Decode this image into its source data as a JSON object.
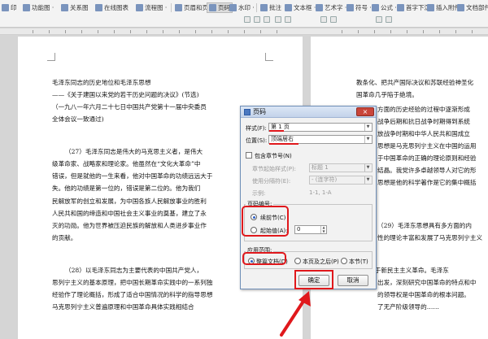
{
  "ribbon": {
    "row1": [
      {
        "key": "print",
        "label": "印"
      },
      {
        "key": "func_map",
        "label": "功能图 ·"
      },
      {
        "key": "relation_map",
        "label": "关系图"
      },
      {
        "key": "online_chart",
        "label": "在线图表"
      },
      {
        "key": "flowchart",
        "label": "流程图 ·"
      },
      {
        "key": "header_footer",
        "label": "页眉和页脚"
      },
      {
        "key": "page_number",
        "label": "页码"
      },
      {
        "key": "watermark",
        "label": "水印 ·"
      },
      {
        "key": "comment",
        "label": "批注"
      },
      {
        "key": "textbox",
        "label": "文本框 ·"
      },
      {
        "key": "wordart",
        "label": "艺术字 ·"
      },
      {
        "key": "symbol",
        "label": "符号 ·"
      },
      {
        "key": "formula",
        "label": "公式 ·"
      },
      {
        "key": "first_char_sink",
        "label": "首字下沉"
      },
      {
        "key": "insert_attachment",
        "label": "插入附件"
      },
      {
        "key": "doc_parts",
        "label": "文档部件 ·"
      }
    ]
  },
  "page1_lines": [
    "毛泽东同志的历史地位和毛泽东思想",
    "——《关于建国以来党的若干历史问题的决议》(节选)",
    "（一九八一年六月二十七日中国共产党第十一届中央委员",
    "全体会议一致通过)",
    "（27）毛泽东同志是伟大的马克思主义者，是伟大",
    "级革命家、战略家和理论家。他虽然在“文化大革命”中",
    "错误，但是就他的一生来看，他对中国革命的功绩远远大于",
    "失。他的功绩是第一位的，错误是第二位的。他为我们",
    "民解放军的创立和发展，为中国各族人民解放事业的胜利",
    "人民共和国的缔造和中国社会主义事业的奠基，建立了永",
    "灭的功勋。他为世界被压迫民族的解放和人类进步事业作",
    "的贡献。",
    "（28）以毛泽东同志为主要代表的中国共产党人，",
    "思列宁主义的基本原理，把中国长期革命实践中的一系列独",
    "经验作了理论概括，形成了适合中国情况的科学的指导思想",
    "马克思列宁主义普遍原理和中国革命具体实践相结合"
  ],
  "page2_lines": [
    "教条化、把共产国际决议和苏联经验神圣化",
    "国革命几乎陷于绝境。",
    "方面的历史经验的过程中逐渐形成",
    "战争后期和抗日战争时期得到系统",
    "放战争时期和中华人民共和国成立",
    "思想是马克思列宁主义在中国的运用",
    "于中国革命的正确的理论原则和经验",
    "结晶。我党许多卓越领导人对它的形",
    "思想是他的科学著作是它的集中概括",
    "（29）毛泽东思想具有多方面的内",
    "性的理论丰富和发展了马克思列宁主义",
    "一、关于新民主主义革命。毛泽东",
    "出发，深刻研究中国革命的特点和中",
    "的领导权是中国革命的根本问题。",
    "了无产阶级领导的……"
  ],
  "dialog": {
    "title": "页码",
    "close_symbol": "×",
    "style_label": "样式(F):",
    "style_value": "第 1 页",
    "position_label": "位置(S):",
    "position_value": "顶端居右",
    "include_chapter_label": "包含章节号(N)",
    "chapter_style_label": "章节起始样式(P):",
    "chapter_style_value": "标题 1",
    "separator_label": "使用分隔符(E):",
    "separator_value": "- (连字符)",
    "example_label": "示例:",
    "example_value": "1-1, 1-A",
    "numbering_group": "页码编号:",
    "continue_prev_label": "续前节(C)",
    "start_at_label": "起始值(A):",
    "start_at_value": "0",
    "apply_group": "应用范围:",
    "apply_whole_doc_label": "整篇文档(D)",
    "apply_this_after_label": "本页及之后(P)",
    "apply_this_section_label": "本节(T)",
    "ok_label": "确定",
    "cancel_label": "取消"
  },
  "colors": {
    "highlight": "#e0181c",
    "dialog_border": "#6f8fb8",
    "close_button": "#c9453a"
  }
}
